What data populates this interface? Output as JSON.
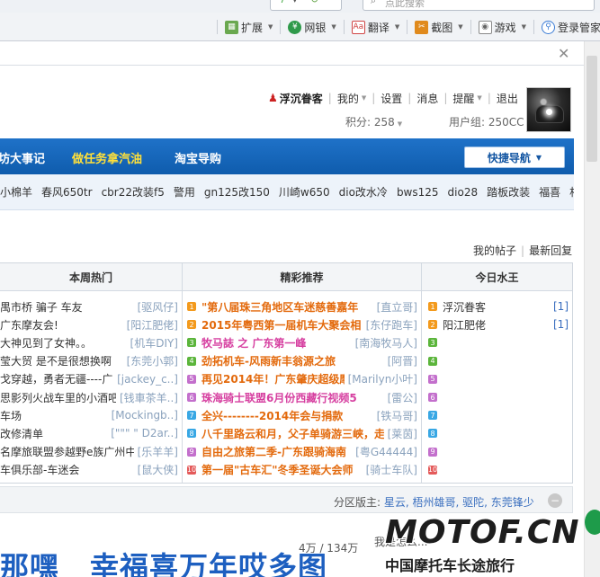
{
  "browser": {
    "search_placeholder": "点此搜索",
    "toolbar": [
      {
        "label": "扩展",
        "icon": "extensions-icon",
        "color": "#6aa84f"
      },
      {
        "label": "网银",
        "icon": "netbank-icon",
        "color": "#2f9a4b"
      },
      {
        "label": "翻译",
        "icon": "translate-icon",
        "color": "#d04545"
      },
      {
        "label": "截图",
        "icon": "screenshot-icon",
        "color": "#e08a1d"
      },
      {
        "label": "游戏",
        "icon": "gamepad-icon",
        "color": "#8a8a8a"
      },
      {
        "label": "登录管家",
        "icon": "login-manager-icon",
        "color": "#3a7bd5"
      }
    ]
  },
  "user": {
    "name": "浮沉眷客",
    "menu": [
      "我的",
      "设置",
      "消息",
      "提醒",
      "退出"
    ],
    "points_label": "积分: 258",
    "group_label": "用户组: 250CC"
  },
  "nav": {
    "items": [
      "坊大事记",
      "做任务拿汽油",
      "淘宝导购"
    ],
    "quick_nav": "快捷导航"
  },
  "tags": [
    "小棉羊",
    "春风650tr",
    "cbr22改装f5",
    "警用",
    "gn125改150",
    "川崎w650",
    "dio改水冷",
    "bws125",
    "dio28",
    "踏板改装",
    "福喜",
    "相机"
  ],
  "links": {
    "my_topics": "我的帖子",
    "latest_replies": "最新回复"
  },
  "columns": {
    "hot": {
      "title": "本周热门",
      "rows": [
        {
          "title": "禺市桥 骗子 车友",
          "author": "[驱风仔]"
        },
        {
          "title": "广东摩友会!",
          "author": "[阳江肥佬]"
        },
        {
          "title": "大神见到了女神。。",
          "author": "[机车DIY]"
        },
        {
          "title": "莹大贸 是不是很想换啊",
          "author": "[东莞小郭]"
        },
        {
          "title": "戈穿越，勇者无疆----广东",
          "author": "[jackey_c..]"
        },
        {
          "title": "思影列火战车里的小酒吧",
          "author": "[钱車茶羊..]"
        },
        {
          "title": "车场",
          "author": "[Mockingb..]"
        },
        {
          "title": "改修清单",
          "author": "[\"\"\" \" D2ar..]"
        },
        {
          "title": "名摩旅联盟参越野e族广州中",
          "author": "[乐羊羊]"
        },
        {
          "title": "车俱乐部-车迷会",
          "author": "[鼠大侠]"
        }
      ]
    },
    "featured": {
      "title": "精彩推荐",
      "rows": [
        {
          "rank": "1",
          "title": "\"第八届珠三角地区车迷慈善嘉年",
          "author": "[直立哥]",
          "style": "hot"
        },
        {
          "rank": "2",
          "title": "2015年粤西第一届机车大聚会相",
          "author": "[东仔跑车]",
          "style": "hot"
        },
        {
          "rank": "3",
          "title": "牧马誌 之 广东第一峰",
          "author": "[南海牧马人]",
          "style": "pink"
        },
        {
          "rank": "4",
          "title": "劲拓机车-风雨新丰翁源之旅",
          "author": "[阿晋]",
          "style": "hot"
        },
        {
          "rank": "5",
          "title": "再见2014年！广东肇庆超级摩",
          "author": "[Marilyn小叶]",
          "style": "hot"
        },
        {
          "rank": "6",
          "title": "珠海骑士联盟6月份西藏行视频5",
          "author": "[雷公]",
          "style": "pink"
        },
        {
          "rank": "7",
          "title": "全兴--------2014年会与捐款",
          "author": "[铁马哥]",
          "style": "hot"
        },
        {
          "rank": "8",
          "title": "八千里路云和月，父子单骑游三峡，走",
          "author": "[莱茵]",
          "style": "hot"
        },
        {
          "rank": "9",
          "title": "自由之旅第二季-广东跟骑海南",
          "author": "[粤G44444]",
          "style": "hot"
        },
        {
          "rank": "10",
          "title": "第一届\"古车汇\"冬季圣诞大会师",
          "author": "[骑士车队]",
          "style": "hot"
        }
      ]
    },
    "water": {
      "title": "今日水王",
      "rows": [
        {
          "rank": "1",
          "name": "浮沉眷客",
          "count": "[1]"
        },
        {
          "rank": "2",
          "name": "阳江肥佬",
          "count": "[1]"
        }
      ],
      "empty_ranks": [
        "3",
        "4",
        "5",
        "6",
        "7",
        "8",
        "9",
        "10"
      ]
    }
  },
  "moderators": {
    "label": "分区版主: ",
    "names": "星云, 梧州雄哥, 驱陀, 东莞锋少"
  },
  "page_info": {
    "threads": "4万 / 134万",
    "last_post": "我是怎么..."
  },
  "banner_text": {
    "first": "那嘿",
    "second": "幸福喜万年哎",
    "third": "多图"
  },
  "watermark": {
    "logo": "MOTOF.CN",
    "sub": "中国摩托车长途旅行"
  }
}
